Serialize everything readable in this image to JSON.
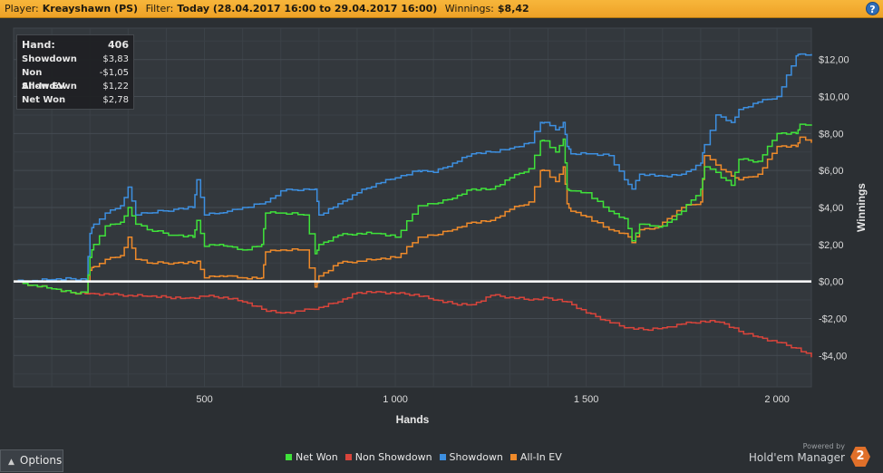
{
  "header": {
    "player_label": "Player:",
    "player_value": "Kreayshawn (PS)",
    "filter_label": "Filter:",
    "filter_value": "Today (28.04.2017 16:00 to 29.04.2017 16:00)",
    "winnings_label": "Winnings:",
    "winnings_value": "$8,42",
    "help_icon": "help-icon",
    "help_glyph": "?"
  },
  "stats": [
    {
      "label": "Hand:",
      "value": "406"
    },
    {
      "label": "Showdown",
      "value": "$3,83"
    },
    {
      "label": "Non Showdown",
      "value": "-$1,05"
    },
    {
      "label": "All-In EV",
      "value": "$1,22"
    },
    {
      "label": "Net Won",
      "value": "$2,78"
    }
  ],
  "footer": {
    "options_label": "Options",
    "options_icon": "caret-up-icon",
    "powered_by": "Powered by",
    "brand_name": "Hold'em Manager",
    "brand_logo_text": "2"
  },
  "colors": {
    "net_won": "#3fe23a",
    "non_showdown": "#d9443b",
    "showdown": "#3d8fe0",
    "all_in_ev": "#ef8a2a",
    "zero_line": "#ffffff"
  },
  "chart_data": {
    "type": "line",
    "xlabel": "Hands",
    "ylabel": "Winnings",
    "xlim": [
      0,
      2090
    ],
    "ylim": [
      -5.7,
      13.7
    ],
    "x_ticks": [
      500,
      1000,
      1500,
      2000
    ],
    "x_tick_labels": [
      "500",
      "1 000",
      "1 500",
      "2 000"
    ],
    "y_ticks": [
      12,
      10,
      8,
      6,
      4,
      2,
      0,
      -2,
      -4
    ],
    "y_tick_labels": [
      "$12,00",
      "$10,00",
      "$8,00",
      "$6,00",
      "$4,00",
      "$2,00",
      "$0,00",
      "-$2,00",
      "-$4,00"
    ],
    "grid": true,
    "legend_position": "bottom",
    "series": [
      {
        "name": "Net Won",
        "color_key": "net_won",
        "x": [
          0,
          50,
          100,
          150,
          190,
          200,
          210,
          240,
          280,
          300,
          320,
          350,
          420,
          470,
          480,
          500,
          540,
          560,
          600,
          650,
          660,
          700,
          760,
          790,
          800,
          850,
          900,
          950,
          1000,
          1060,
          1070,
          1100,
          1150,
          1200,
          1250,
          1300,
          1350,
          1380,
          1390,
          1420,
          1440,
          1450,
          1460,
          1500,
          1560,
          1600,
          1620,
          1640,
          1680,
          1700,
          1750,
          1800,
          1810,
          1840,
          1880,
          1900,
          1950,
          2000,
          2050,
          2060,
          2090
        ],
        "y": [
          0,
          -0.2,
          -0.4,
          -0.6,
          -0.6,
          1.3,
          2.0,
          3.0,
          3.2,
          4.0,
          3.1,
          2.8,
          2.5,
          2.4,
          3.3,
          1.9,
          2.0,
          1.9,
          1.7,
          2.0,
          3.7,
          3.7,
          3.6,
          1.5,
          2.0,
          2.5,
          2.6,
          2.6,
          2.4,
          4.1,
          4.1,
          4.2,
          4.5,
          5.0,
          5.0,
          5.6,
          6.1,
          7.6,
          7.6,
          7.0,
          7.7,
          5.0,
          4.9,
          4.8,
          3.8,
          3.4,
          2.2,
          3.1,
          3.0,
          3.0,
          3.8,
          5.0,
          6.2,
          5.9,
          5.2,
          6.6,
          6.5,
          8.0,
          8.0,
          8.5,
          8.42
        ]
      },
      {
        "name": "Non Showdown",
        "color_key": "non_showdown",
        "x": [
          0,
          50,
          100,
          150,
          200,
          250,
          300,
          350,
          400,
          450,
          500,
          550,
          600,
          650,
          700,
          750,
          800,
          850,
          900,
          950,
          1000,
          1050,
          1100,
          1150,
          1200,
          1250,
          1300,
          1350,
          1400,
          1450,
          1500,
          1550,
          1600,
          1650,
          1700,
          1750,
          1800,
          1850,
          1900,
          1950,
          2000,
          2050,
          2090
        ],
        "y": [
          0,
          -0.2,
          -0.4,
          -0.6,
          -0.65,
          -0.7,
          -0.75,
          -0.8,
          -0.85,
          -0.9,
          -0.8,
          -0.85,
          -1.1,
          -1.5,
          -1.7,
          -1.6,
          -1.4,
          -1.1,
          -0.6,
          -0.55,
          -0.65,
          -0.7,
          -1.0,
          -1.2,
          -1.25,
          -0.75,
          -0.85,
          -1.0,
          -0.9,
          -1.1,
          -1.7,
          -2.1,
          -2.5,
          -2.6,
          -2.5,
          -2.3,
          -2.15,
          -2.2,
          -2.7,
          -3.0,
          -3.3,
          -3.6,
          -4.1
        ]
      },
      {
        "name": "Showdown",
        "color_key": "showdown",
        "x": [
          0,
          50,
          100,
          150,
          190,
          200,
          210,
          240,
          280,
          300,
          320,
          350,
          420,
          470,
          480,
          500,
          540,
          560,
          600,
          660,
          700,
          760,
          790,
          800,
          850,
          900,
          950,
          1000,
          1060,
          1070,
          1100,
          1150,
          1200,
          1250,
          1300,
          1350,
          1380,
          1390,
          1420,
          1440,
          1450,
          1460,
          1500,
          1560,
          1600,
          1620,
          1640,
          1680,
          1700,
          1750,
          1800,
          1810,
          1840,
          1880,
          1900,
          1950,
          2000,
          2050,
          2060,
          2090
        ],
        "y": [
          0,
          0.05,
          0.1,
          0.15,
          0.1,
          2.6,
          3.1,
          3.7,
          4.1,
          5.1,
          3.6,
          3.7,
          3.9,
          4.0,
          5.5,
          3.6,
          3.7,
          3.8,
          4.0,
          4.3,
          4.9,
          5.0,
          5.0,
          3.6,
          4.2,
          4.8,
          5.3,
          5.6,
          6.0,
          6.0,
          5.9,
          6.4,
          6.9,
          7.0,
          7.2,
          7.5,
          8.6,
          8.6,
          8.2,
          8.6,
          7.3,
          6.9,
          6.9,
          6.8,
          5.5,
          5.0,
          5.8,
          5.7,
          5.7,
          5.8,
          6.4,
          7.4,
          9.0,
          8.6,
          9.3,
          9.7,
          10.0,
          12.2,
          12.3,
          12.3
        ]
      },
      {
        "name": "All-In EV",
        "color_key": "all_in_ev",
        "x": [
          0,
          50,
          100,
          150,
          190,
          200,
          210,
          240,
          280,
          300,
          320,
          350,
          420,
          470,
          480,
          500,
          540,
          560,
          600,
          650,
          660,
          700,
          760,
          790,
          800,
          850,
          900,
          950,
          1000,
          1060,
          1070,
          1100,
          1150,
          1200,
          1250,
          1300,
          1350,
          1380,
          1390,
          1420,
          1440,
          1450,
          1460,
          1500,
          1560,
          1600,
          1620,
          1640,
          1680,
          1700,
          1750,
          1800,
          1810,
          1840,
          1880,
          1900,
          1950,
          2000,
          2050,
          2060,
          2090
        ],
        "y": [
          0,
          -0.2,
          -0.4,
          -0.6,
          -0.6,
          0.6,
          0.8,
          1.2,
          1.4,
          2.4,
          1.2,
          1.0,
          1.0,
          1.0,
          1.1,
          0.2,
          0.3,
          0.3,
          0.2,
          0.2,
          1.6,
          1.7,
          1.7,
          -0.3,
          0.3,
          1.0,
          1.1,
          1.2,
          1.3,
          2.4,
          2.4,
          2.5,
          2.8,
          3.2,
          3.3,
          3.9,
          4.3,
          6.0,
          6.0,
          5.4,
          6.2,
          4.2,
          3.8,
          3.5,
          2.8,
          2.6,
          2.1,
          2.8,
          2.9,
          3.2,
          4.0,
          4.3,
          6.8,
          6.3,
          5.7,
          5.5,
          5.8,
          7.3,
          7.3,
          7.8,
          7.5
        ]
      }
    ]
  }
}
